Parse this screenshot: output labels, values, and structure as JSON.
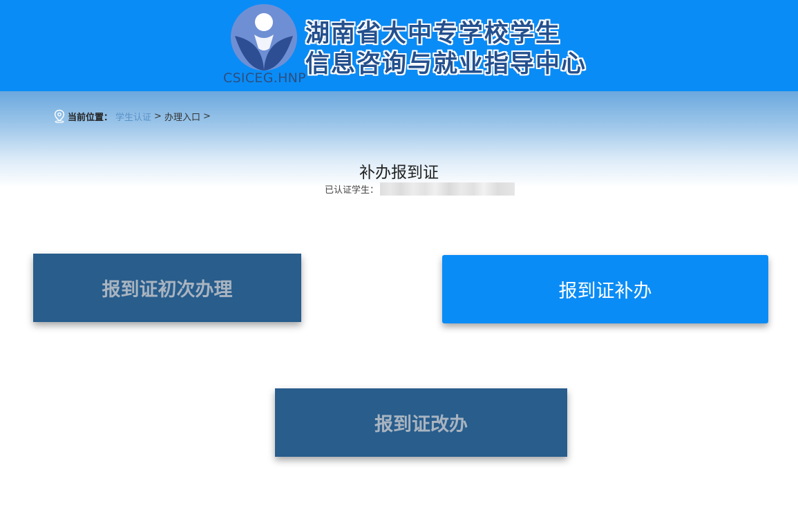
{
  "header": {
    "logo_latin": "CSICEG.HNP",
    "title_line1": "湖南省大中专学校学生",
    "title_line2": "信息咨询与就业指导中心",
    "background_color": "#0a8cf6",
    "title_color": "#24508e"
  },
  "breadcrumb": {
    "icon": "location-pin-icon",
    "label": "当前位置：",
    "items": [
      {
        "text": "学生认证",
        "is_link": true
      },
      {
        "text": "办理入口",
        "is_link": false
      }
    ],
    "separator": ">"
  },
  "main": {
    "title": "补办报到证",
    "student_label": "已认证学生："
  },
  "actions": [
    {
      "label": "报到证初次办理",
      "style": "dark",
      "color": "#285d8c"
    },
    {
      "label": "报到证补办",
      "style": "bright",
      "color": "#0a8cf6"
    },
    {
      "label": "报到证改办",
      "style": "dark",
      "color": "#285d8c"
    }
  ]
}
